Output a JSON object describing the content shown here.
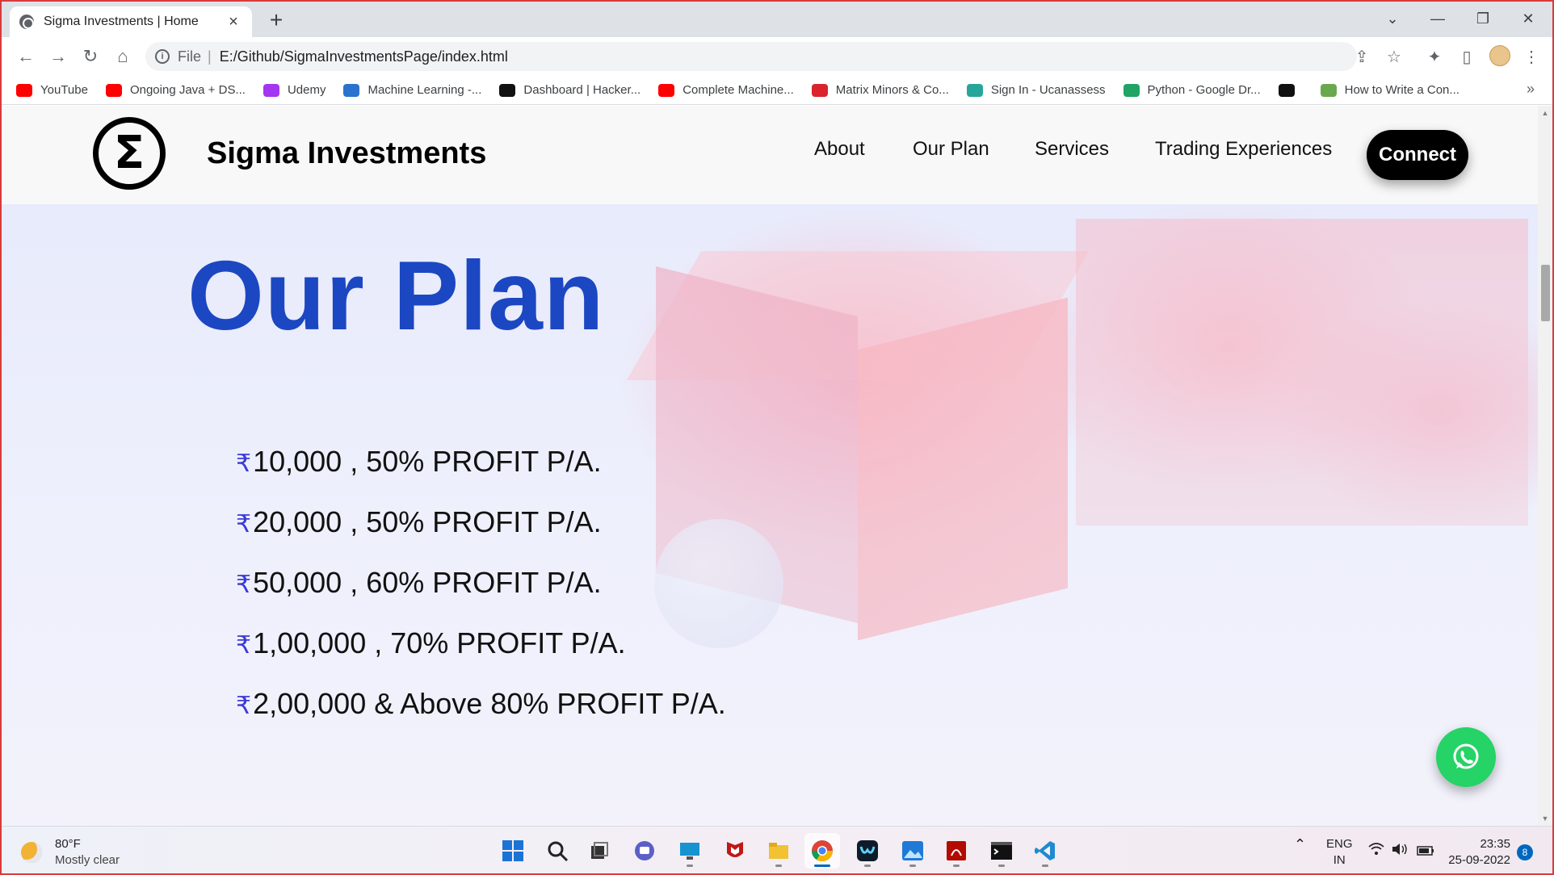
{
  "browser": {
    "tab_title": "Sigma Investments | Home",
    "address_scheme": "File",
    "address_url": "E:/Github/SigmaInvestmentsPage/index.html"
  },
  "bookmarks": [
    {
      "label": "YouTube",
      "icon": "youtube-icon",
      "color": "#ff0000"
    },
    {
      "label": "Ongoing Java + DS...",
      "icon": "youtube-icon",
      "color": "#ff0000"
    },
    {
      "label": "Udemy",
      "icon": "udemy-icon",
      "color": "#a435f0"
    },
    {
      "label": "Machine Learning -...",
      "icon": "coursera-icon",
      "color": "#2a73cc"
    },
    {
      "label": "Dashboard | Hacker...",
      "icon": "hackerrank-icon",
      "color": "#111111"
    },
    {
      "label": "Complete Machine...",
      "icon": "youtube-icon",
      "color": "#ff0000"
    },
    {
      "label": "Matrix Minors & Co...",
      "icon": "symbolab-icon",
      "color": "#d9232d"
    },
    {
      "label": "Sign In - Ucanassess",
      "icon": "ucanassess-icon",
      "color": "#26a69a"
    },
    {
      "label": "Python - Google Dr...",
      "icon": "google-drive-icon",
      "color": "#1fa463"
    },
    {
      "label": "",
      "icon": "hackerrank-icon",
      "color": "#111111"
    },
    {
      "label": "How to Write a Con...",
      "icon": "site-icon",
      "color": "#6aa84f"
    }
  ],
  "site": {
    "brand": "Sigma Investments",
    "logo_symbol": "Σ",
    "nav": [
      "About",
      "Our Plan",
      "Services",
      "Trading Experiences"
    ],
    "connect_label": "Connect"
  },
  "hero": {
    "title": "Our Plan",
    "currency_symbol": "₹",
    "plans": [
      "10,000 , 50% PROFIT P/A.",
      "20,000 , 50% PROFIT P/A.",
      "50,000 , 60% PROFIT P/A.",
      "1,00,000 , 70% PROFIT P/A.",
      "2,00,000 & Above 80% PROFIT P/A."
    ]
  },
  "taskbar": {
    "weather_temp": "80°F",
    "weather_cond": "Mostly clear",
    "lang_top": "ENG",
    "lang_bottom": "IN",
    "time": "23:35",
    "date": "25-09-2022",
    "notifications": "8"
  },
  "colors": {
    "accent_blue": "#1c47c2",
    "rupee": "#3b3ad6",
    "whatsapp": "#25d366",
    "window_border": "#d93a3a"
  }
}
